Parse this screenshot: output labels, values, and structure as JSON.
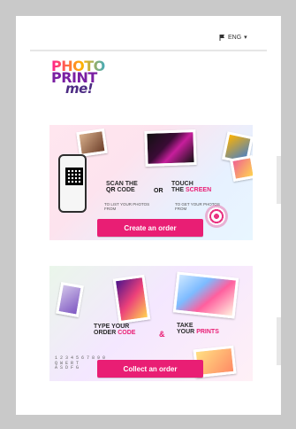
{
  "header": {
    "language_label": "ENG"
  },
  "logo": {
    "line1": "PHOTO",
    "line2": "PRINT",
    "line3": "me!"
  },
  "cards": {
    "create": {
      "button_label": "Create an order",
      "scan_prefix": "SCAN THE",
      "qr_word": "QR",
      "code_word": "CODE",
      "or_label": "OR",
      "touch_prefix": "TOUCH",
      "the_word": "THE",
      "screen_word": "SCREEN",
      "hint_left": "TO LIST YOUR\nPHOTOS FROM",
      "hint_right": "TO GET YOUR\nPHOTOS FROM"
    },
    "collect": {
      "button_label": "Collect an order",
      "type_prefix": "TYPE YOUR",
      "order_word": "ORDER",
      "code_word": "CODE",
      "amp": "&",
      "take_prefix": "TAKE",
      "your_word": "YOUR",
      "prints_word": "PRINTS",
      "keypad_line1": "1 2 3 4 5 6 7 8 9 0",
      "keypad_line2": "Q W E R T",
      "keypad_line3": "A S D F G"
    }
  },
  "colors": {
    "accent": "#e91e74",
    "logo_purple": "#7a1fa2"
  }
}
